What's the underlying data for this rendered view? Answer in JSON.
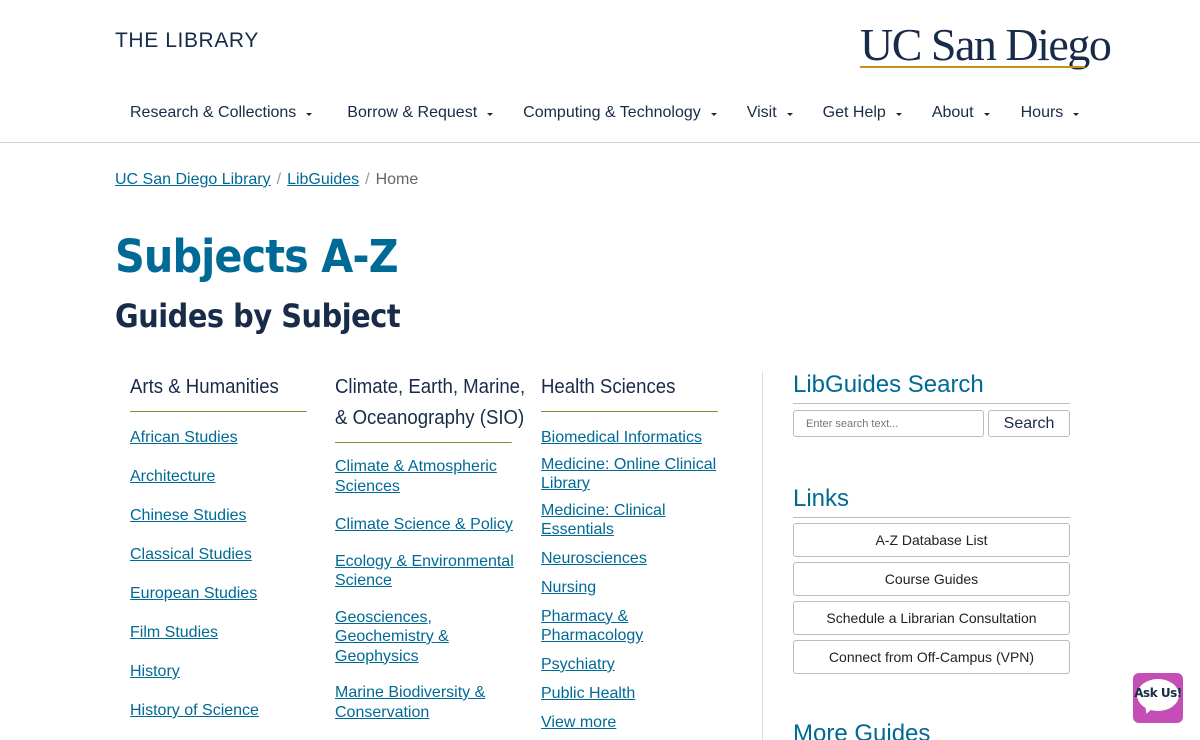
{
  "header": {
    "site_name": "THE LIBRARY",
    "logo_text": "UC San Diego",
    "nav": [
      {
        "label": "Research & Collections"
      },
      {
        "label": "Borrow & Request"
      },
      {
        "label": "Computing & Technology"
      },
      {
        "label": "Visit"
      },
      {
        "label": "Get Help"
      },
      {
        "label": "About"
      },
      {
        "label": "Hours"
      }
    ]
  },
  "breadcrumb": {
    "items": [
      "UC San Diego Library",
      "LibGuides"
    ],
    "current": "Home",
    "separator": "/"
  },
  "page": {
    "title": "Subjects A-Z",
    "subtitle": "Guides by Subject"
  },
  "columns": [
    {
      "heading": "Arts & Humanities",
      "links": [
        "African Studies",
        "Architecture",
        "Chinese Studies",
        "Classical Studies",
        "European Studies",
        "Film Studies",
        "History",
        "History of Science"
      ]
    },
    {
      "heading_line1": "Climate, Earth, Marine,",
      "heading_line2": "& Oceanography (SIO)",
      "links": [
        "Climate & Atmospheric Sciences",
        "Climate Science & Policy",
        "Ecology & Environmental Science",
        "Geosciences, Geochemistry & Geophysics",
        "Marine Biodiversity & Conservation"
      ]
    },
    {
      "heading": "Health Sciences",
      "links": [
        "Biomedical Informatics",
        "Medicine: Online Clinical Library",
        "Medicine: Clinical Essentials",
        "Neurosciences",
        "Nursing",
        "Pharmacy & Pharmacology",
        "Psychiatry",
        "Public Health",
        "View more"
      ]
    }
  ],
  "sidebar": {
    "search_title": "LibGuides Search",
    "search_placeholder": "Enter search text...",
    "search_button": "Search",
    "links_title": "Links",
    "links": [
      "A-Z Database List",
      "Course Guides",
      "Schedule a Librarian Consultation",
      "Connect from Off-Campus (VPN)"
    ],
    "more_title": "More Guides"
  },
  "chat_widget": {
    "label": "Ask Us!"
  },
  "colors": {
    "primary": "#182b49",
    "link": "#006a96",
    "accent_gold": "#c69214",
    "rule_green": "#6e963b",
    "chat": "#c34fb6"
  }
}
